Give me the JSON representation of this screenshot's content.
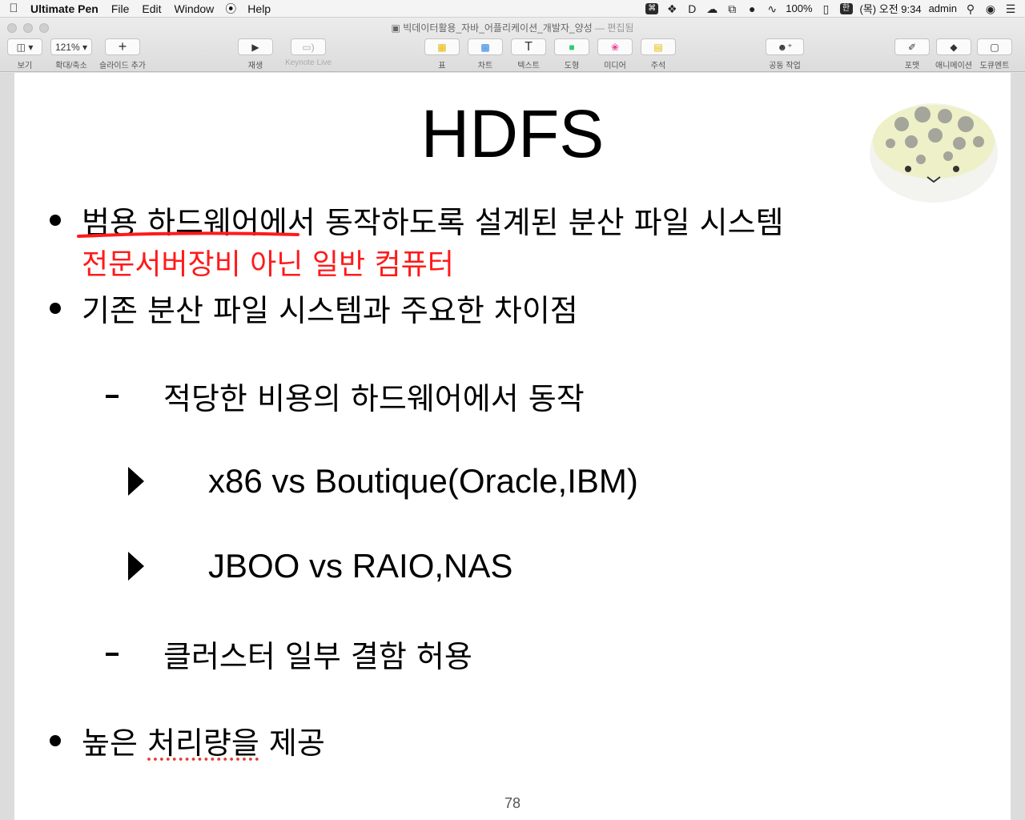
{
  "menubar": {
    "app_name": "Ultimate Pen",
    "menus": [
      "File",
      "Edit",
      "Window",
      "Help"
    ],
    "status": {
      "battery": "100%",
      "input_method": "한",
      "clock": "(목) 오전 9:34",
      "user": "admin"
    }
  },
  "window": {
    "title": "빅데이터활용_자바_어플리케이션_개발자_양성",
    "edited": "— 편집됨"
  },
  "toolbar": {
    "view_label": "보기",
    "zoom_value": "121%",
    "zoom_label": "확대/축소",
    "add_slide_label": "슬라이드 추가",
    "play_label": "재생",
    "keynote_live_label": "Keynote Live",
    "table_label": "표",
    "chart_label": "차트",
    "text_label": "텍스트",
    "shape_label": "도형",
    "media_label": "미디어",
    "comment_label": "주석",
    "collaborate_label": "공동 작업",
    "format_label": "포맷",
    "animate_label": "애니메이션",
    "document_label": "도큐멘트"
  },
  "slide": {
    "title": "HDFS",
    "bullet1": "범용 하드웨어에서 동작하도록 설계된 분산 파일 시스템",
    "annotation": "전문서버장비 아닌 일반 컴퓨터",
    "bullet2": "기존 분산 파일 시스템과 주요한 차이점",
    "sub1": "적당한 비용의 하드웨어에서 동작",
    "subsub1": "x86 vs Boutique(Oracle,IBM)",
    "subsub2": "JBOO vs RAIO,NAS",
    "sub2": "클러스터 일부 결함 허용",
    "bullet3_a": "높은 ",
    "bullet3_b": "처리량을",
    "bullet3_c": " 제공",
    "page_number": "78"
  },
  "colors": {
    "annotation_red": "#ff1a1a",
    "slide_bg": "#ffffff",
    "text": "#000000"
  }
}
